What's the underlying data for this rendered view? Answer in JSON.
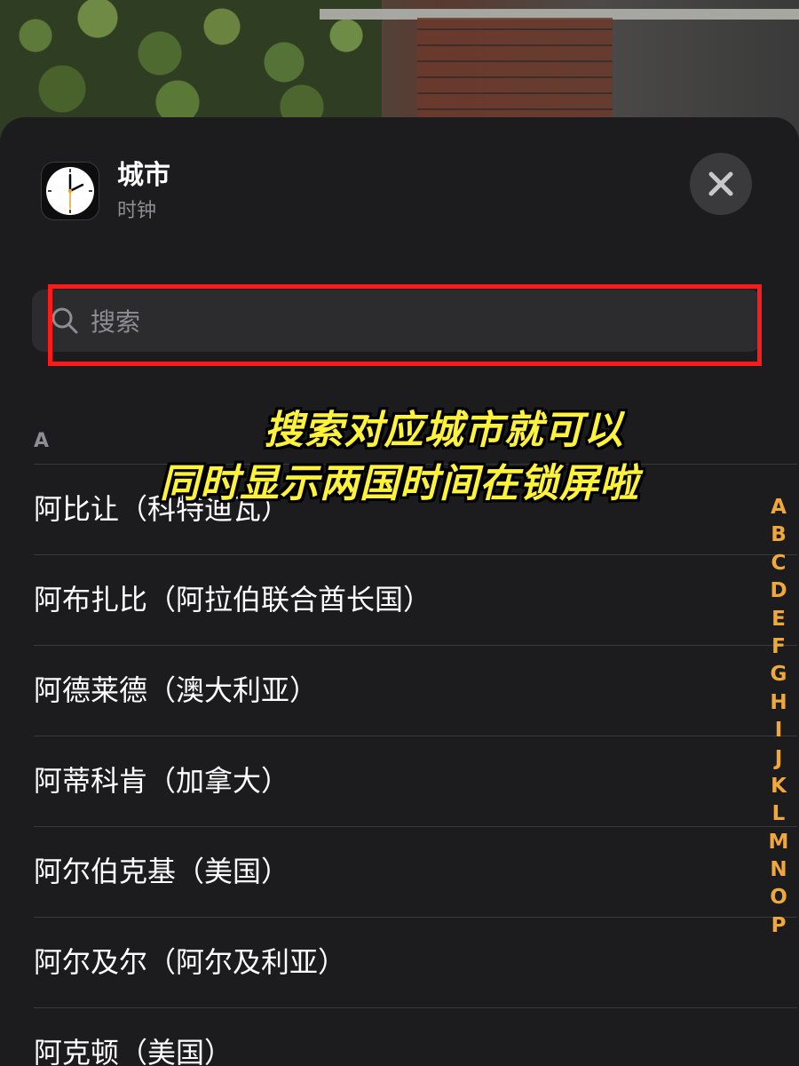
{
  "header": {
    "title": "城市",
    "subtitle": "时钟"
  },
  "search": {
    "placeholder": "搜索",
    "value": ""
  },
  "section": {
    "letter": "A"
  },
  "cities": [
    "阿比让（科特迪瓦）",
    "阿布扎比（阿拉伯联合酋长国）",
    "阿德莱德（澳大利亚）",
    "阿蒂科肯（加拿大）",
    "阿尔伯克基（美国）",
    "阿尔及尔（阿尔及利亚）",
    "阿克顿（美国）"
  ],
  "alpha_index": [
    "A",
    "B",
    "C",
    "D",
    "E",
    "F",
    "G",
    "H",
    "I",
    "J",
    "K",
    "L",
    "M",
    "N",
    "O",
    "P"
  ],
  "caption": {
    "line1": "搜索对应城市就可以",
    "line2": "同时显示两国时间在锁屏啦"
  },
  "icons": {
    "app": "clock-icon",
    "close": "close-icon",
    "search": "search-icon"
  },
  "colors": {
    "sheet_bg": "#1c1c1e",
    "accent_index": "#f0a83a",
    "highlight": "#ff1a1a",
    "caption": "#fff23b"
  }
}
